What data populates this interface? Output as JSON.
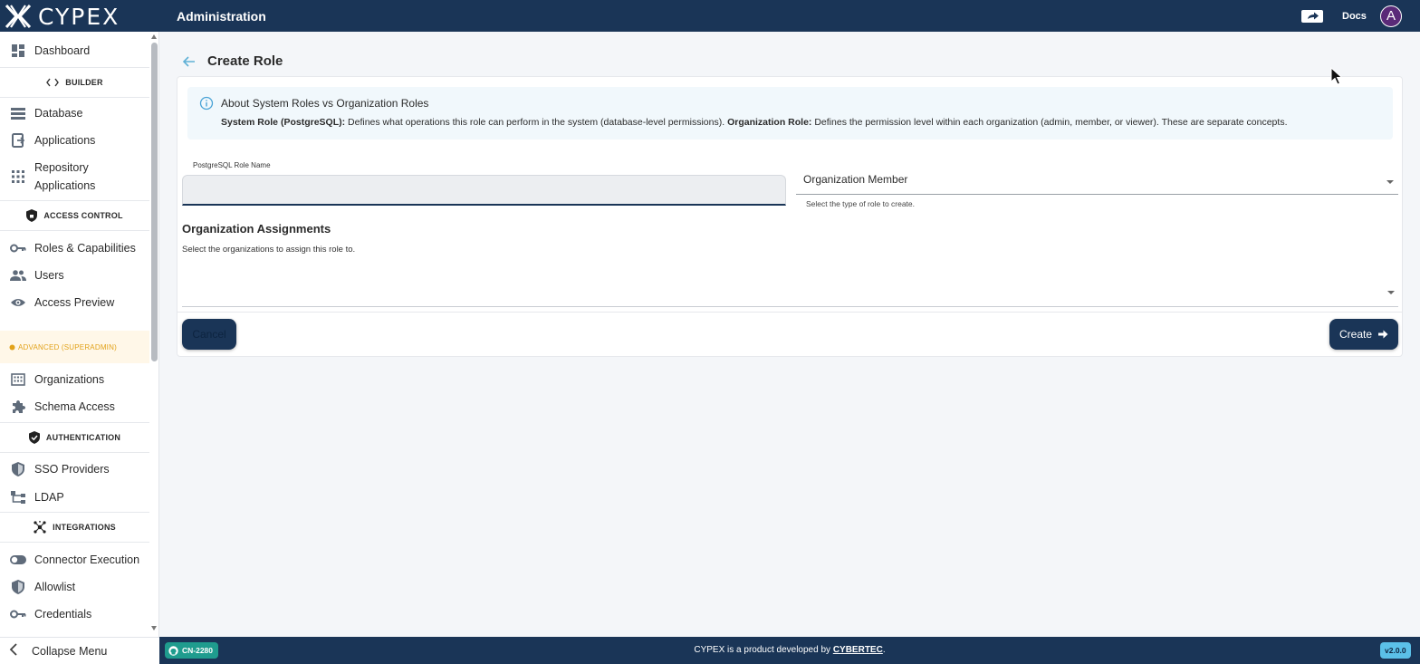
{
  "app": {
    "logo_text": "CYPEX",
    "header_title": "Administration",
    "docs_label": "Docs",
    "avatar_initial": "A"
  },
  "sidebar": {
    "items": [
      {
        "label": "Dashboard",
        "icon": "dashboard-icon"
      },
      {
        "label": "Database",
        "icon": "database-icon"
      },
      {
        "label": "Applications",
        "icon": "applications-icon"
      },
      {
        "label": "Repository Applications",
        "icon": "grid-icon"
      },
      {
        "label": "Roles & Capabilities",
        "icon": "key-icon"
      },
      {
        "label": "Users",
        "icon": "users-icon"
      },
      {
        "label": "Access Preview",
        "icon": "eye-icon"
      },
      {
        "label": "Organizations",
        "icon": "building-icon"
      },
      {
        "label": "Schema Access",
        "icon": "puzzle-icon"
      },
      {
        "label": "SSO Providers",
        "icon": "shield-icon"
      },
      {
        "label": "LDAP",
        "icon": "tree-icon"
      },
      {
        "label": "Connector Execution",
        "icon": "toggle-icon"
      },
      {
        "label": "Allowlist",
        "icon": "shield-icon"
      },
      {
        "label": "Credentials",
        "icon": "key-icon"
      }
    ],
    "sections": {
      "builder": "BUILDER",
      "access_control": "ACCESS CONTROL",
      "advanced": "ADVANCED (SUPERADMIN)",
      "authentication": "AUTHENTICATION",
      "integrations": "INTEGRATIONS"
    },
    "collapse_label": "Collapse Menu"
  },
  "page": {
    "title": "Create Role",
    "info": {
      "title": "About System Roles vs Organization Roles",
      "system_role_label": "System Role (PostgreSQL):",
      "system_role_text": " Defines what operations this role can perform in the system (database-level permissions). ",
      "org_role_label": "Organization Role:",
      "org_role_text": " Defines the permission level within each organization (admin, member, or viewer). These are separate concepts."
    },
    "role_name": {
      "label": "PostgreSQL Role Name",
      "value": ""
    },
    "role_type": {
      "selected": "Organization Member",
      "helper": "Select the type of role to create."
    },
    "assignments": {
      "title": "Organization Assignments",
      "subtitle": "Select the organizations to assign this role to."
    },
    "buttons": {
      "cancel": "Cancel",
      "create": "Create"
    }
  },
  "footer": {
    "branch": "CN-2280",
    "text_prefix": "CYPEX is a product developed by ",
    "company": "CYBERTEC",
    "text_suffix": ".",
    "version": "v2.0.0"
  },
  "colors": {
    "primary": "#1a3557",
    "accent_teal": "#1f9c8e",
    "version_badge": "#5bc0e8",
    "advanced_section": "#e2a21a",
    "info_bg": "#f1f8fc"
  }
}
